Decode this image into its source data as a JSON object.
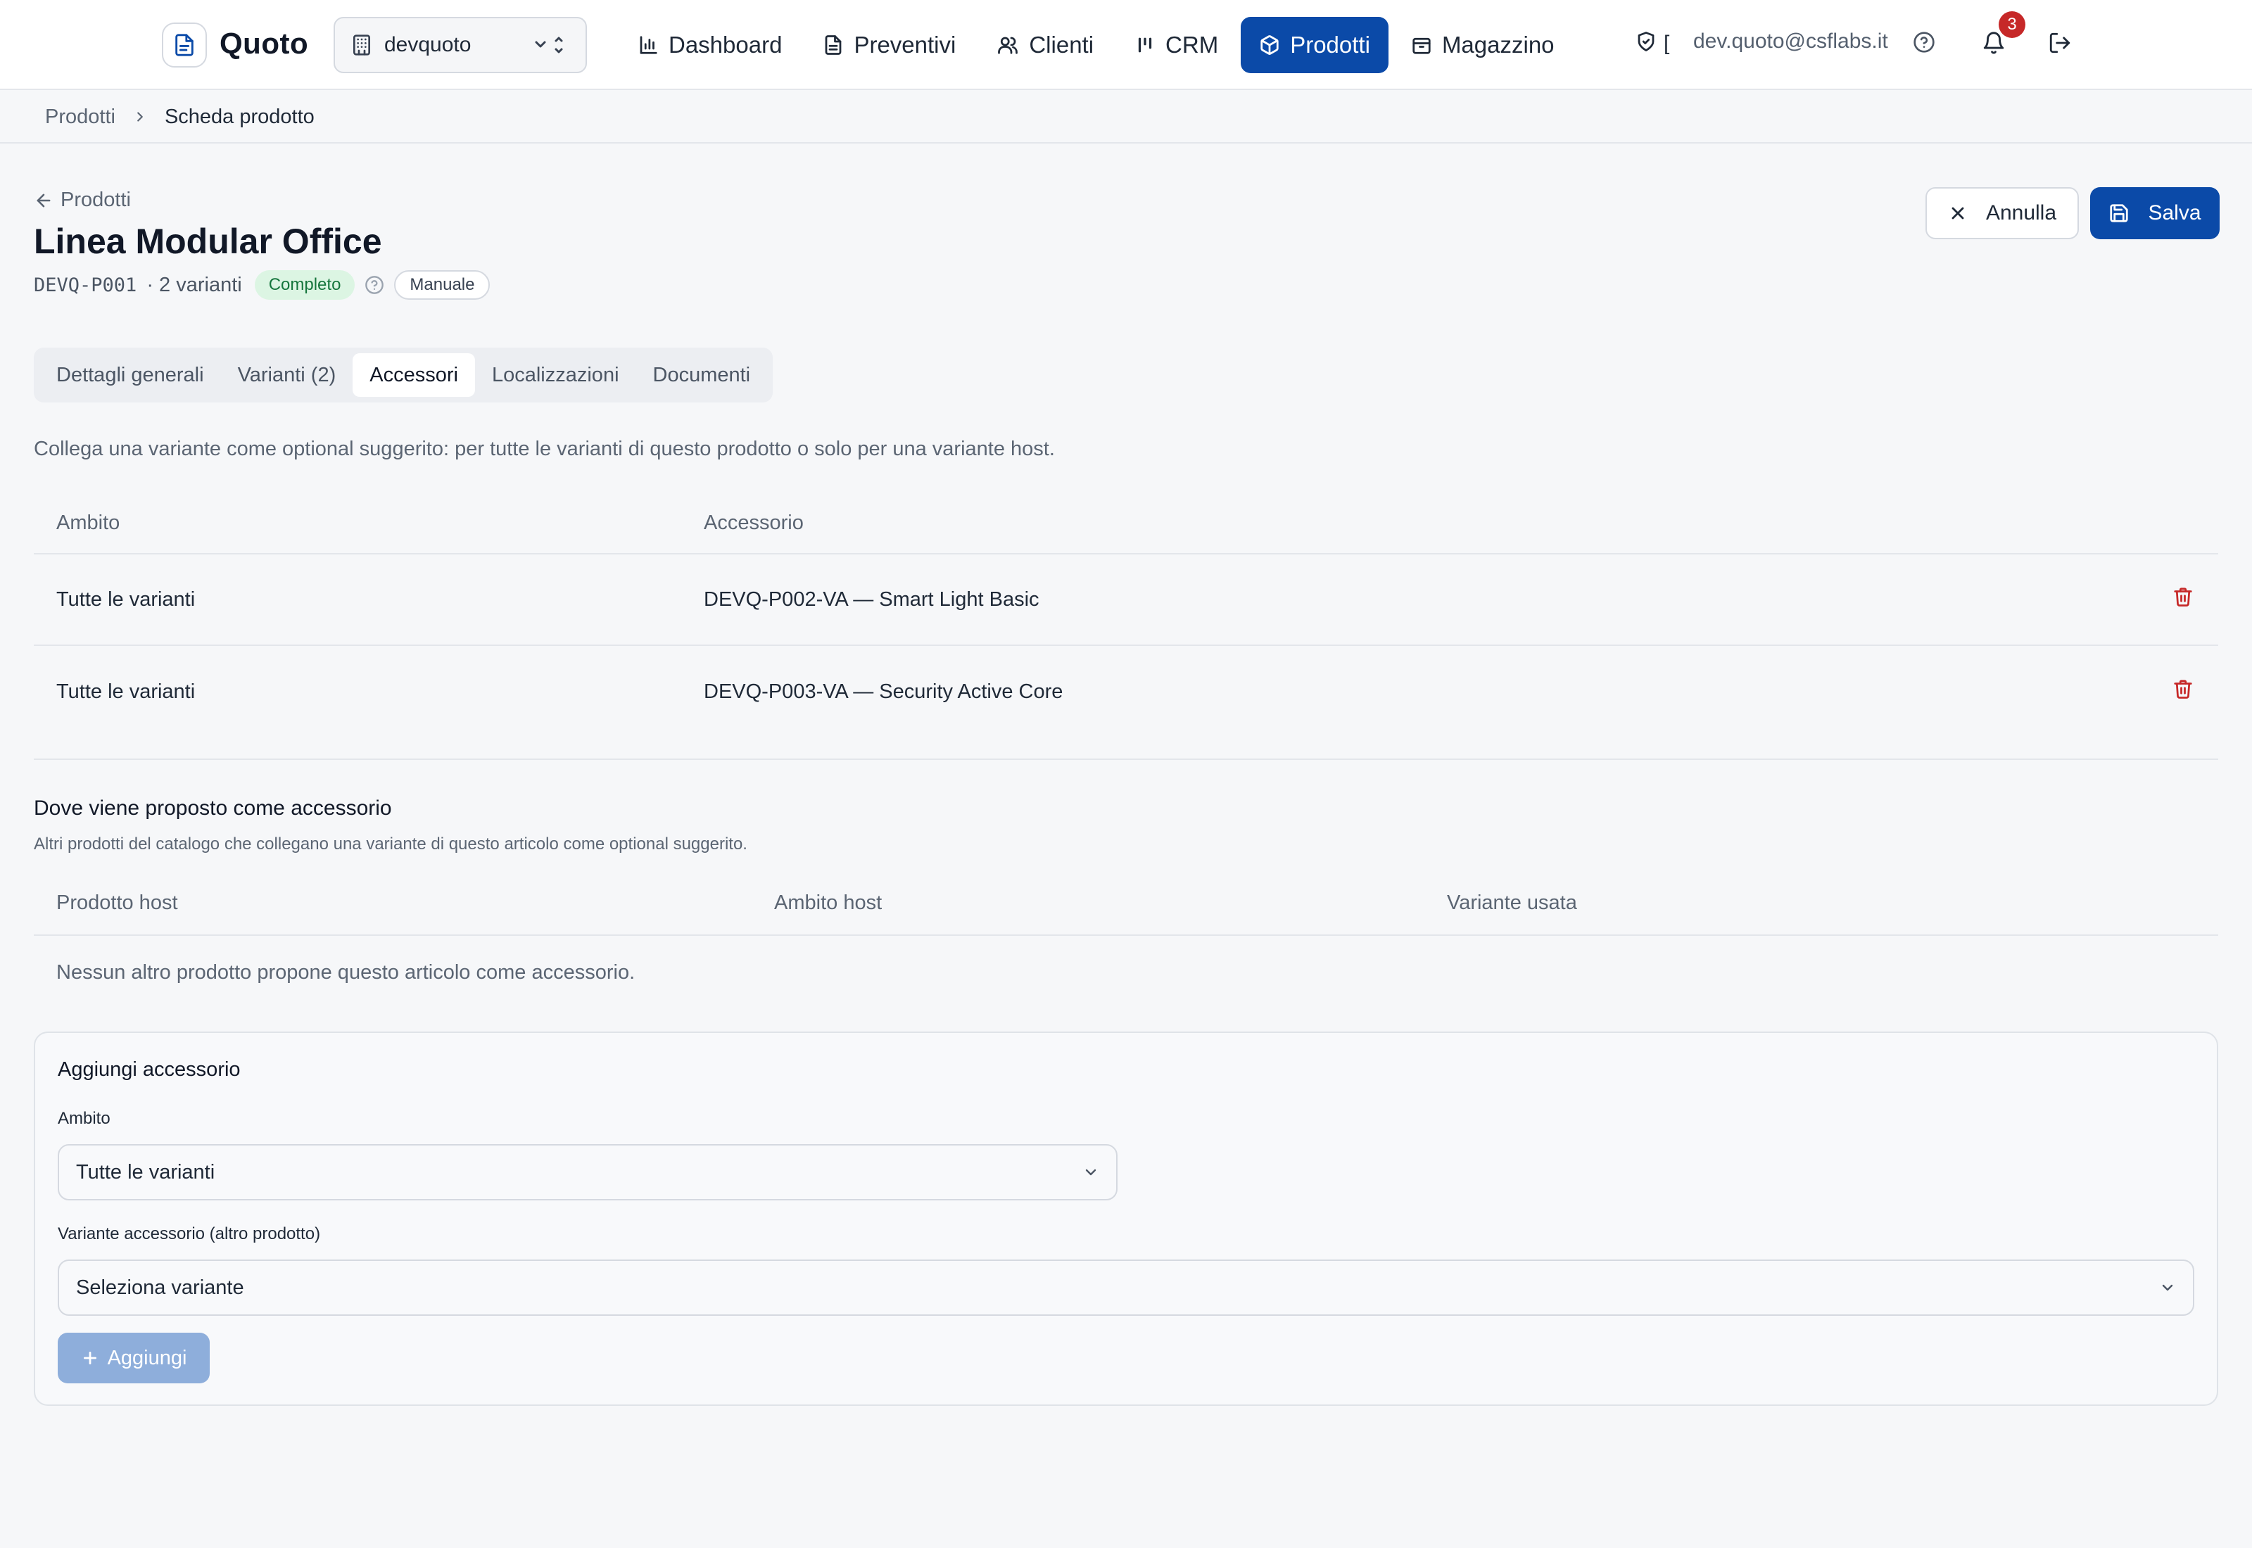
{
  "app": {
    "name": "Quoto",
    "workspace": "devquoto"
  },
  "nav": {
    "items": [
      {
        "label": "Dashboard",
        "icon": "bar-chart-icon"
      },
      {
        "label": "Preventivi",
        "icon": "document-icon"
      },
      {
        "label": "Clienti",
        "icon": "users-icon"
      },
      {
        "label": "CRM",
        "icon": "kanban-icon"
      },
      {
        "label": "Prodotti",
        "icon": "box-icon",
        "active": true
      },
      {
        "label": "Magazzino",
        "icon": "warehouse-icon"
      }
    ],
    "truncated_item": "[",
    "user_email": "dev.quoto@csflabs.it",
    "notifications_count": "3"
  },
  "breadcrumb": {
    "parent": "Prodotti",
    "current": "Scheda prodotto"
  },
  "product": {
    "back_label": "Prodotti",
    "title": "Linea Modular Office",
    "sku": "DEVQ-P001",
    "variants_count": "· 2 varianti",
    "status": "Completo",
    "source": "Manuale"
  },
  "actions": {
    "cancel": "Annulla",
    "save": "Salva"
  },
  "tabs": [
    {
      "label": "Dettagli generali"
    },
    {
      "label": "Varianti (2)"
    },
    {
      "label": "Accessori",
      "active": true
    },
    {
      "label": "Localizzazioni"
    },
    {
      "label": "Documenti"
    }
  ],
  "accessories": {
    "intro": "Collega una variante come optional suggerito: per tutte le varianti di questo prodotto o solo per una variante host.",
    "columns": {
      "scope": "Ambito",
      "accessory": "Accessorio"
    },
    "rows": [
      {
        "scope": "Tutte le varianti",
        "accessory": "DEVQ-P002-VA — Smart Light Basic"
      },
      {
        "scope": "Tutte le varianti",
        "accessory": "DEVQ-P003-VA — Security Active Core"
      }
    ]
  },
  "proposed": {
    "title": "Dove viene proposto come accessorio",
    "subtitle": "Altri prodotti del catalogo che collegano una variante di questo articolo come optional suggerito.",
    "columns": {
      "host": "Prodotto host",
      "host_scope": "Ambito host",
      "variant": "Variante usata"
    },
    "empty": "Nessun altro prodotto propone questo articolo come accessorio."
  },
  "add_form": {
    "title": "Aggiungi accessorio",
    "scope_label": "Ambito",
    "scope_value": "Tutte le varianti",
    "variant_label": "Variante accessorio (altro prodotto)",
    "variant_placeholder": "Seleziona variante",
    "add_button": "Aggiungi"
  },
  "colors": {
    "primary": "#0b4aa8",
    "primary_disabled": "#8eaedb",
    "danger": "#c62828",
    "success_bg": "#dcf5e3",
    "success_text": "#16763d"
  }
}
